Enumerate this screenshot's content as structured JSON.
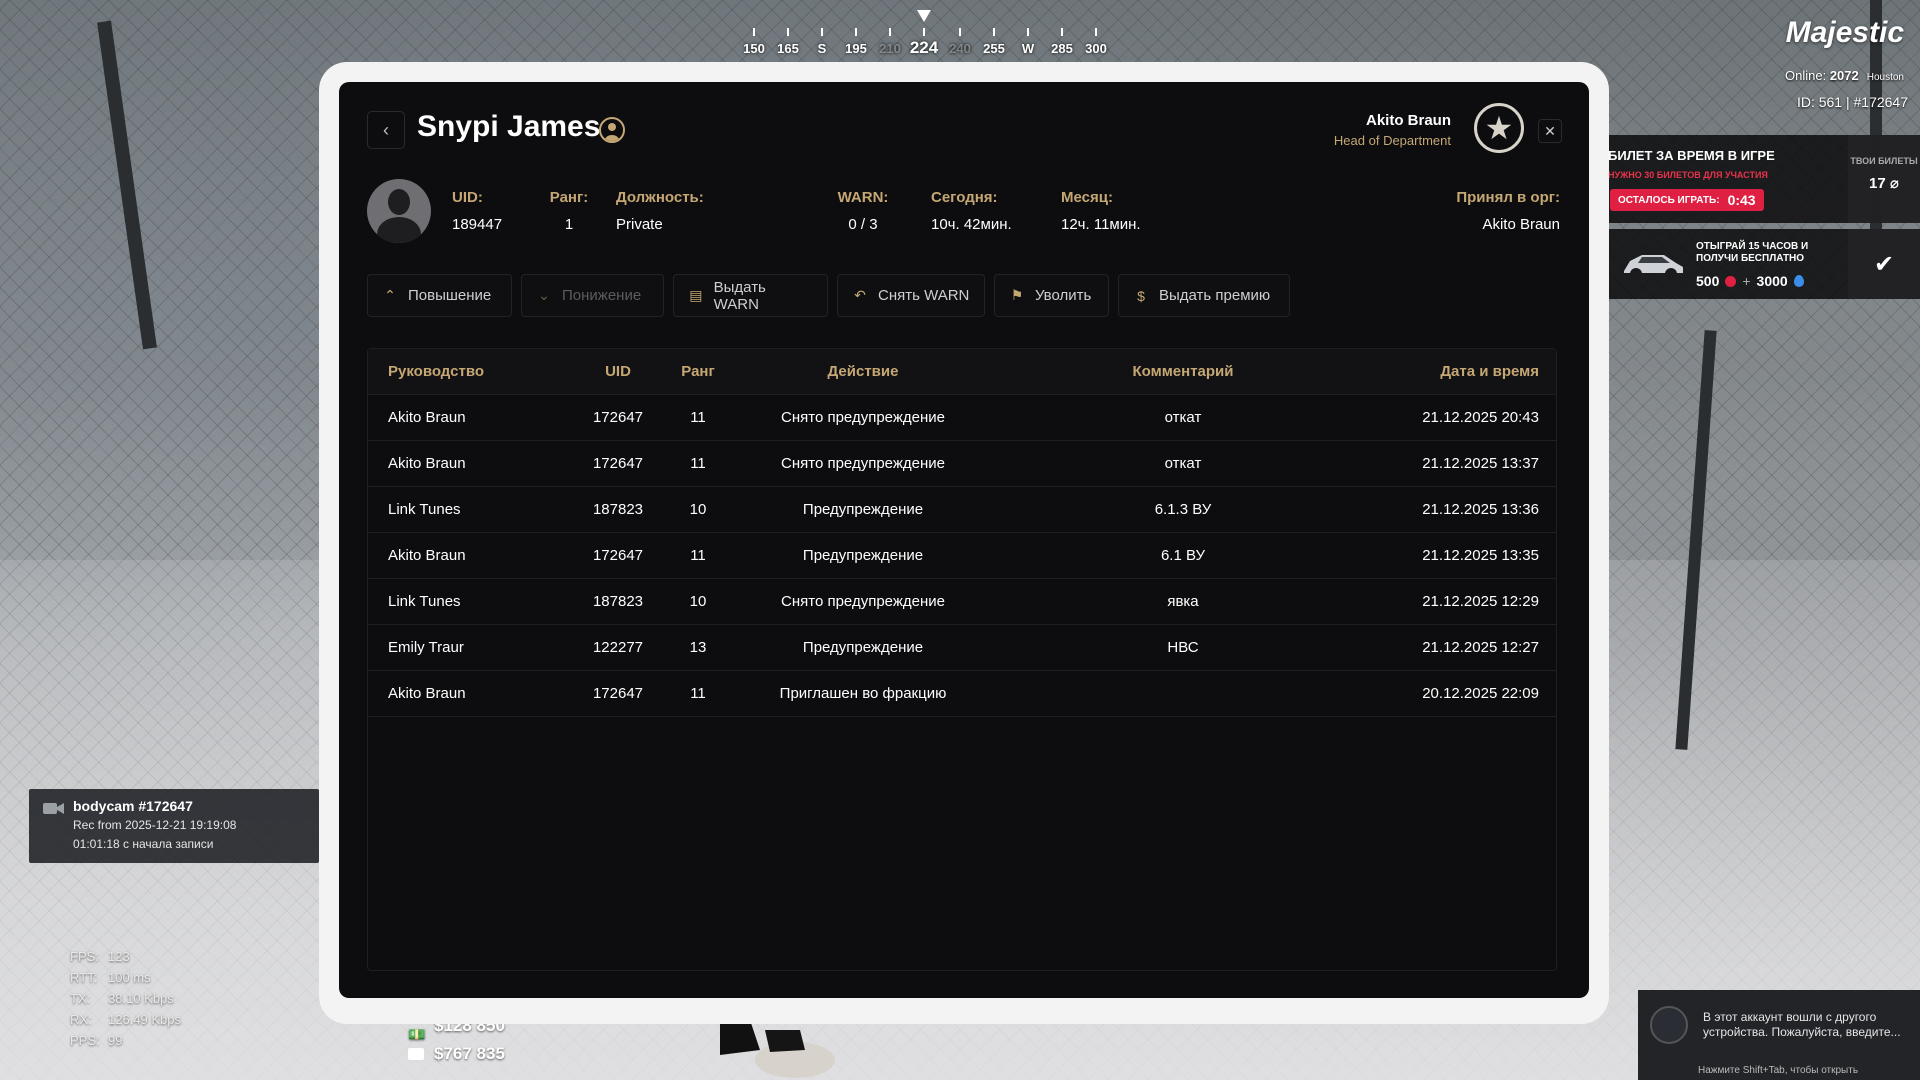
{
  "compass": {
    "marks": [
      {
        "label": "150",
        "style": "normal"
      },
      {
        "label": "165",
        "style": "normal"
      },
      {
        "label": "S",
        "style": "normal"
      },
      {
        "label": "195",
        "style": "normal"
      },
      {
        "label": "210",
        "style": "dim"
      },
      {
        "label": "224",
        "style": "big"
      },
      {
        "label": "240",
        "style": "dim"
      },
      {
        "label": "255",
        "style": "normal"
      },
      {
        "label": "W",
        "style": "normal"
      },
      {
        "label": "285",
        "style": "normal"
      },
      {
        "label": "300",
        "style": "normal"
      }
    ]
  },
  "hud": {
    "brand": "Majestic",
    "online_label": "Online:",
    "online_value": "2072",
    "server": "Houston",
    "id_text": "ID: 561 | #172647"
  },
  "ticket": {
    "title": "БИЛЕТ ЗА ВРЕМЯ В ИГРЕ",
    "subtitle": "НУЖНО 30 БИЛЕТОВ ДЛЯ УЧАСТИЯ",
    "remaining_label": "ОСТАЛОСЬ ИГРАТЬ:",
    "remaining_value": "0:43",
    "yours_label": "ТВОИ БИЛЕТЫ",
    "yours_value": "17"
  },
  "promo": {
    "title": "ОТЫГРАЙ 15 ЧАСОВ И ПОЛУЧИ БЕСПЛАТНО",
    "value1": "500",
    "plus": "+",
    "value2": "3000"
  },
  "bodycam": {
    "title": "bodycam #172647",
    "rec": "Rec from 2025-12-21 19:19:08",
    "elapsed": "01:01:18 с начала записи"
  },
  "netstats": [
    {
      "k": "FPS:",
      "v": "123"
    },
    {
      "k": "RTT:",
      "v": "100 ms"
    },
    {
      "k": "TX:",
      "v": "38.10 Kbps"
    },
    {
      "k": "RX:",
      "v": "126.49 Kbps"
    },
    {
      "k": "PPS:",
      "v": "99"
    }
  ],
  "money": {
    "cash": "$128 850",
    "bank": "$767 835"
  },
  "steam": {
    "text": "В этот аккаунт вошли с другого устройства. Пожалуйста, введите...",
    "footer": "Нажмите Shift+Tab, чтобы открыть"
  },
  "panel": {
    "name": "Snypi James",
    "leader_name": "Akito Braun",
    "leader_role": "Head of Department",
    "close_symbol": "✕",
    "back_symbol": "‹",
    "info": {
      "uid_label": "UID:",
      "uid_value": "189447",
      "rank_label": "Ранг:",
      "rank_value": "1",
      "position_label": "Должность:",
      "position_value": "Private",
      "warn_label": "WARN:",
      "warn_value": "0 / 3",
      "today_label": "Сегодня:",
      "today_value": "10ч. 42мин.",
      "month_label": "Месяц:",
      "month_value": "12ч. 11мин.",
      "accepted_label": "Принял в орг:",
      "accepted_value": "Akito Braun"
    },
    "actions": [
      {
        "label": "Повышение",
        "icon": "chevron-up-icon",
        "glyph": "⌃",
        "disabled": false
      },
      {
        "label": "Понижение",
        "icon": "chevron-down-icon",
        "glyph": "⌄",
        "disabled": true
      },
      {
        "label": "Выдать WARN",
        "icon": "warn-doc-icon",
        "glyph": "▤",
        "disabled": false
      },
      {
        "label": "Снять WARN",
        "icon": "undo-icon",
        "glyph": "↶",
        "disabled": false
      },
      {
        "label": "Уволить",
        "icon": "dismiss-icon",
        "glyph": "⚑",
        "disabled": false
      },
      {
        "label": "Выдать премию",
        "icon": "coin-icon",
        "glyph": "$",
        "disabled": false
      }
    ],
    "table": {
      "headers": [
        "Руководство",
        "UID",
        "Ранг",
        "Действие",
        "Комментарий",
        "Дата и время"
      ],
      "rows": [
        [
          "Akito Braun",
          "172647",
          "11",
          "Снято предупреждение",
          "откат",
          "21.12.2025 20:43"
        ],
        [
          "Akito Braun",
          "172647",
          "11",
          "Снято предупреждение",
          "откат",
          "21.12.2025 13:37"
        ],
        [
          "Link Tunes",
          "187823",
          "10",
          "Предупреждение",
          "6.1.3 ВУ",
          "21.12.2025 13:36"
        ],
        [
          "Akito Braun",
          "172647",
          "11",
          "Предупреждение",
          "6.1 ВУ",
          "21.12.2025 13:35"
        ],
        [
          "Link Tunes",
          "187823",
          "10",
          "Снято предупреждение",
          "явка",
          "21.12.2025 12:29"
        ],
        [
          "Emily Traur",
          "122277",
          "13",
          "Предупреждение",
          "НВС",
          "21.12.2025 12:27"
        ],
        [
          "Akito Braun",
          "172647",
          "11",
          "Приглашен во фракцию",
          "",
          "20.12.2025 22:09"
        ]
      ]
    }
  }
}
